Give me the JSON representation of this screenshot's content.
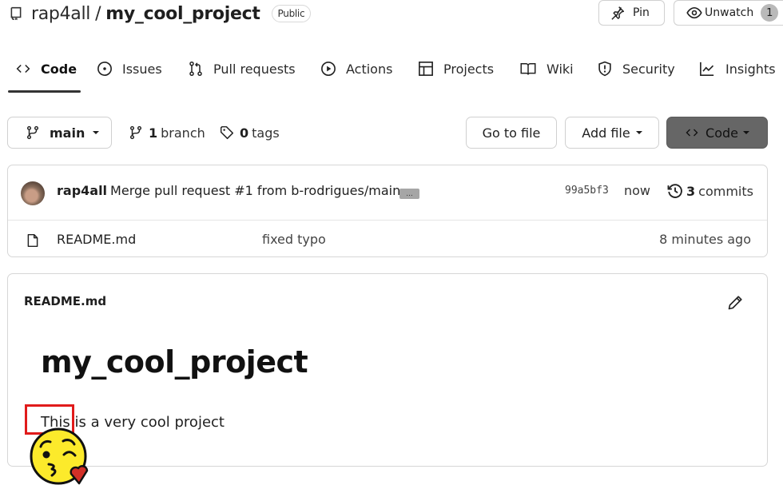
{
  "header": {
    "owner": "rap4all",
    "separator": "/",
    "repo_name": "my_cool_project",
    "visibility_badge": "Public",
    "pin_label": "Pin",
    "unwatch_label": "Unwatch",
    "watch_count": "1"
  },
  "tabs": [
    {
      "label": "Code",
      "icon": "code-icon",
      "active": true
    },
    {
      "label": "Issues",
      "icon": "issue-icon",
      "active": false
    },
    {
      "label": "Pull requests",
      "icon": "pull-request-icon",
      "active": false
    },
    {
      "label": "Actions",
      "icon": "play-icon",
      "active": false
    },
    {
      "label": "Projects",
      "icon": "table-icon",
      "active": false
    },
    {
      "label": "Wiki",
      "icon": "book-icon",
      "active": false
    },
    {
      "label": "Security",
      "icon": "shield-icon",
      "active": false
    },
    {
      "label": "Insights",
      "icon": "graph-icon",
      "active": false
    }
  ],
  "branch_bar": {
    "current_branch": "main",
    "branch_count": "1",
    "branch_label": "branch",
    "tag_count": "0",
    "tag_label": "tags",
    "goto_file_label": "Go to file",
    "add_file_label": "Add file",
    "code_button_label": "Code"
  },
  "latest_commit": {
    "author": "rap4all",
    "message": "Merge pull request #1 from b-rodrigues/main",
    "ellipsis": "...",
    "sha": "99a5bf3",
    "time": "now",
    "commit_count": "3",
    "commit_label": "commits"
  },
  "files": [
    {
      "name": "README.md",
      "message": "fixed typo",
      "age": "8 minutes ago",
      "icon": "file-icon"
    }
  ],
  "readme": {
    "filename": "README.md",
    "heading": "my_cool_project",
    "paragraph": "This is a very cool project"
  },
  "overlay": {
    "highlight_color": "#e01b1b",
    "emoji": "face-blowing-a-kiss"
  },
  "colors": {
    "code_button_bg": "#666666",
    "count_badge_bg": "#b9b9b9",
    "border": "#d0d0d0"
  }
}
